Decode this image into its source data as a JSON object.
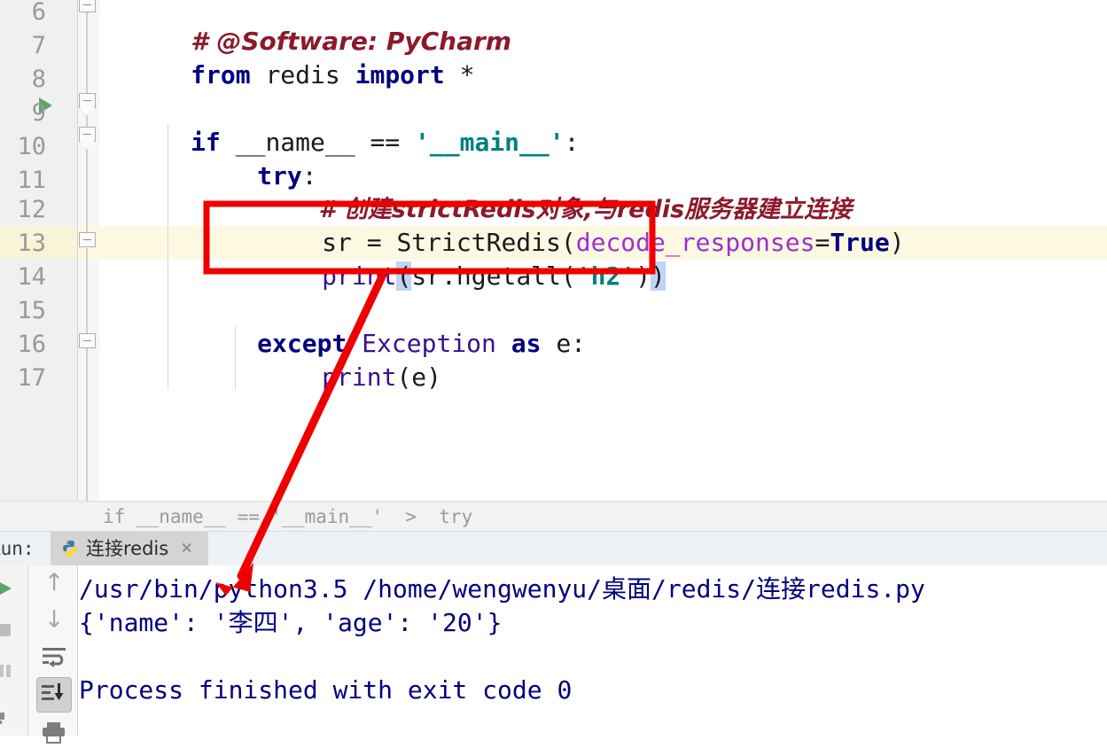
{
  "editor": {
    "line_numbers": [
      "6",
      "7",
      "8",
      "9",
      "10",
      "11",
      "12",
      "13",
      "14",
      "15",
      "16",
      "17"
    ],
    "lines": [
      {
        "n": "6",
        "indent": 0,
        "kind": "comment",
        "text": "# @Software: PyCharm"
      },
      {
        "n": "7",
        "indent": 0,
        "kind": "code",
        "text": "from redis import *"
      },
      {
        "n": "8",
        "indent": 0,
        "kind": "blank",
        "text": ""
      },
      {
        "n": "9",
        "indent": 0,
        "kind": "code",
        "text": "if __name__ == '__main__':"
      },
      {
        "n": "10",
        "indent": 1,
        "kind": "code",
        "text": "try:"
      },
      {
        "n": "11",
        "indent": 2,
        "kind": "comment",
        "text": "# 创建strictRedis对象,与redis服务器建立连接"
      },
      {
        "n": "12",
        "indent": 2,
        "kind": "code",
        "text": "sr = StrictRedis(decode_responses=True)"
      },
      {
        "n": "13",
        "indent": 2,
        "kind": "code",
        "text": "print(sr.hgetall('h2'))"
      },
      {
        "n": "14",
        "indent": 0,
        "kind": "blank",
        "text": ""
      },
      {
        "n": "15",
        "indent": 1,
        "kind": "code",
        "text": "except Exception as e:"
      },
      {
        "n": "16",
        "indent": 2,
        "kind": "code",
        "text": "print(e)"
      },
      {
        "n": "17",
        "indent": 0,
        "kind": "blank",
        "text": ""
      }
    ],
    "highlighted_line": "13",
    "run_marker_line": "9",
    "tokens": {
      "l6_comment": "# @Software: PyCharm",
      "l7_from": "from",
      "l7_module": " redis ",
      "l7_import": "import",
      "l7_star": " *",
      "l9_if": "if",
      "l9_name": " __name__ ",
      "l9_eq": "== ",
      "l9_q1": "'",
      "l9_main": "__main__",
      "l9_q2": "'",
      "l9_colon": ":",
      "l10_try": "try",
      "l10_colon": ":",
      "l11_comment": "# 创建strictRedis对象,与redis服务器建立连接",
      "l12_a": "sr = StrictRedis(",
      "l12_kwarg": "decode_responses",
      "l12_eq": "=",
      "l12_true": "True",
      "l12_close": ")",
      "l13_print": "print",
      "l13_open": "(",
      "l13_mid": "sr.hgetall(",
      "l13_str": "'h2'",
      "l13_inner": ")",
      "l13_close": ")",
      "l15_except": "except",
      "l15_exc": " Exception ",
      "l15_as": "as",
      "l15_e": " e:",
      "l16_print": "print",
      "l16_args": "(e)"
    }
  },
  "breadcrumb": {
    "text": "if __name__ == '__main__'  >  try"
  },
  "run_tool": {
    "label": "Run:",
    "tab_title": "连接redis",
    "tab_close_glyph": "×",
    "python_icon": "python-icon",
    "sidebar_icons": [
      {
        "name": "rerun-icon"
      },
      {
        "name": "stop-icon"
      },
      {
        "name": "pause-icon"
      },
      {
        "name": "trash-icon"
      }
    ],
    "toolbar_icons": [
      {
        "name": "up-arrow-icon",
        "glyph": "↑",
        "selected": false
      },
      {
        "name": "down-arrow-icon",
        "glyph": "↓",
        "selected": false
      },
      {
        "name": "soft-wrap-icon",
        "glyph": "",
        "selected": false
      },
      {
        "name": "scroll-to-end-icon",
        "glyph": "",
        "selected": true
      },
      {
        "name": "print-icon",
        "glyph": "",
        "selected": false
      }
    ]
  },
  "console": {
    "lines": [
      "/usr/bin/python3.5 /home/wengwenyu/桌面/redis/连接redis.py",
      "{'name': '李四', 'age': '20'}",
      "",
      "Process finished with exit code 0"
    ]
  },
  "annotations": {
    "highlight_box": {
      "label": "red-rectangle-highlight"
    },
    "arrow": {
      "label": "red-pointer-arrow"
    }
  },
  "colors": {
    "keyword": "#000080",
    "string": "#008080",
    "comment": "#8b1a2b",
    "kwarg": "#9b30d0",
    "console_text": "#000080",
    "line_highlight": "#fdf8e2",
    "annotation_red": "#ee0000",
    "run_green": "#59a869"
  }
}
